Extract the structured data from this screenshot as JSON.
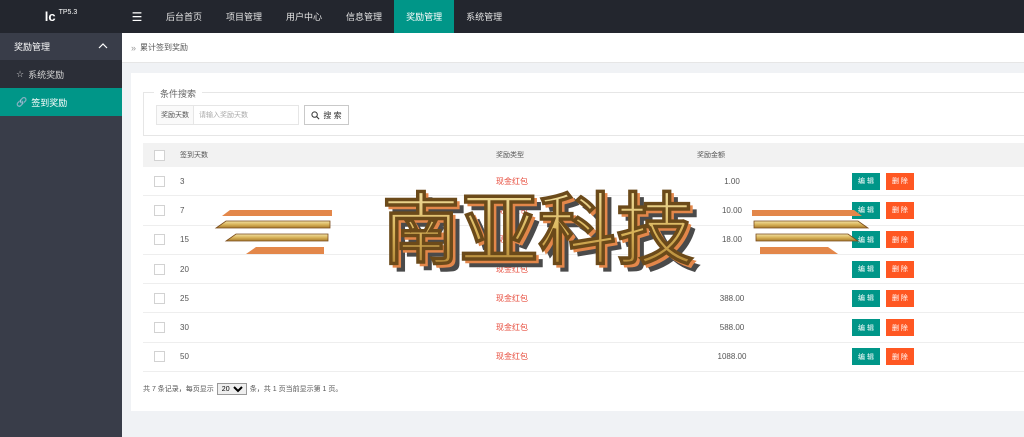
{
  "app": {
    "logo": "lc",
    "version": "TP5.3"
  },
  "topnav": [
    {
      "label": "后台首页",
      "active": false
    },
    {
      "label": "项目管理",
      "active": false
    },
    {
      "label": "用户中心",
      "active": false
    },
    {
      "label": "信息管理",
      "active": false
    },
    {
      "label": "奖励管理",
      "active": true
    },
    {
      "label": "系统管理",
      "active": false
    }
  ],
  "sidebar": {
    "group": "奖励管理",
    "items": [
      {
        "label": "系统奖励",
        "icon": "star-icon",
        "active": false
      },
      {
        "label": "签到奖励",
        "icon": "link-icon",
        "active": true
      }
    ]
  },
  "breadcrumb": "累计签到奖励",
  "search": {
    "legend": "条件搜索",
    "label": "奖励天数",
    "placeholder": "请输入奖励天数",
    "button": "搜 索"
  },
  "table": {
    "headers": {
      "days": "签到天数",
      "type": "奖励类型",
      "amount": "奖励金额"
    },
    "rows": [
      {
        "days": "3",
        "type": "现金红包",
        "amount": "1.00"
      },
      {
        "days": "7",
        "type": "现金红包",
        "amount": "10.00"
      },
      {
        "days": "15",
        "type": "现金红包",
        "amount": "18.00"
      },
      {
        "days": "20",
        "type": "现金红包",
        "amount": ""
      },
      {
        "days": "25",
        "type": "现金红包",
        "amount": "388.00"
      },
      {
        "days": "30",
        "type": "现金红包",
        "amount": "588.00"
      },
      {
        "days": "50",
        "type": "现金红包",
        "amount": "1088.00"
      }
    ],
    "edit_label": "编 辑",
    "delete_label": "删 除"
  },
  "pager": {
    "prefix": "共 7 条记录，每页显示",
    "page_size": "20",
    "suffix": "条，共 1 页当前显示第 1 页。"
  },
  "watermark": {
    "text": "南亚科技"
  },
  "colors": {
    "accent": "#009688",
    "danger": "#ff5722",
    "topbar": "#23262e",
    "sidebar": "#393d49"
  }
}
